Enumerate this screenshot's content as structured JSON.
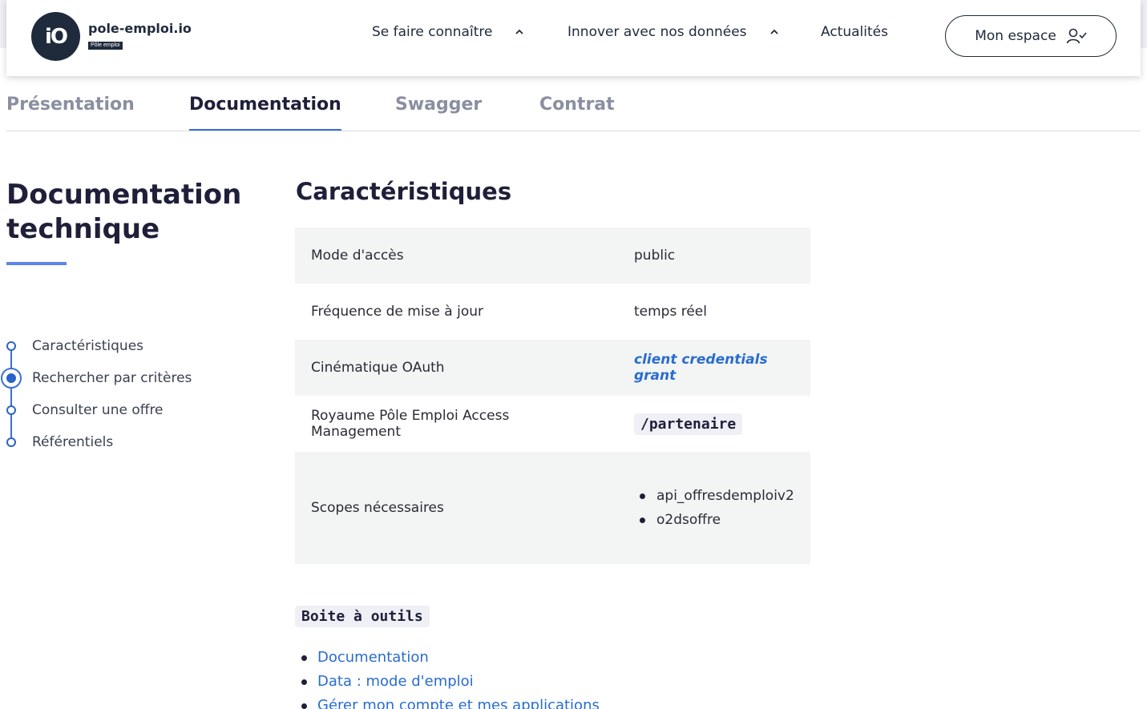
{
  "header": {
    "logo_mark": "iO",
    "logo_text": "pole-emploi.io",
    "logo_badge": "Pôle emploi",
    "nav": [
      {
        "label": "Se faire connaître",
        "has_chevron": true
      },
      {
        "label": "Innover avec nos données",
        "has_chevron": true
      },
      {
        "label": "Actualités",
        "has_chevron": false
      }
    ],
    "account_button": "Mon espace",
    "account_icon": "user-check-icon"
  },
  "tabs": [
    {
      "label": "Présentation",
      "active": false
    },
    {
      "label": "Documentation",
      "active": true
    },
    {
      "label": "Swagger",
      "active": false
    },
    {
      "label": "Contrat",
      "active": false
    }
  ],
  "sidebar": {
    "title_line1": "Documentation",
    "title_line2": "technique",
    "toc": [
      {
        "label": "Caractéristiques",
        "active": false
      },
      {
        "label": "Rechercher par critères",
        "active": true
      },
      {
        "label": "Consulter une offre",
        "active": false
      },
      {
        "label": "Référentiels",
        "active": false
      }
    ]
  },
  "main": {
    "section_title": "Caractéristiques",
    "rows": [
      {
        "key": "Mode d'accès",
        "value": "public"
      },
      {
        "key": "Fréquence de mise à jour",
        "value": "temps réel"
      },
      {
        "key": "Cinématique OAuth",
        "value": "client credentials grant"
      },
      {
        "key": "Royaume Pôle Emploi Access Management",
        "value": "/partenaire"
      },
      {
        "key": "Scopes nécessaires",
        "scopes": [
          "api_offresdemploiv2",
          "o2dsoffre"
        ]
      }
    ],
    "toolbox_label": "Boite à outils",
    "tools": [
      "Documentation",
      "Data : mode d'emploi",
      "Gérer mon compte et mes applications"
    ]
  },
  "colors": {
    "accent": "#3b6fd6",
    "link": "#2a6ccf",
    "dark": "#1f2a3c",
    "row_shade": "#f2f5f4"
  }
}
